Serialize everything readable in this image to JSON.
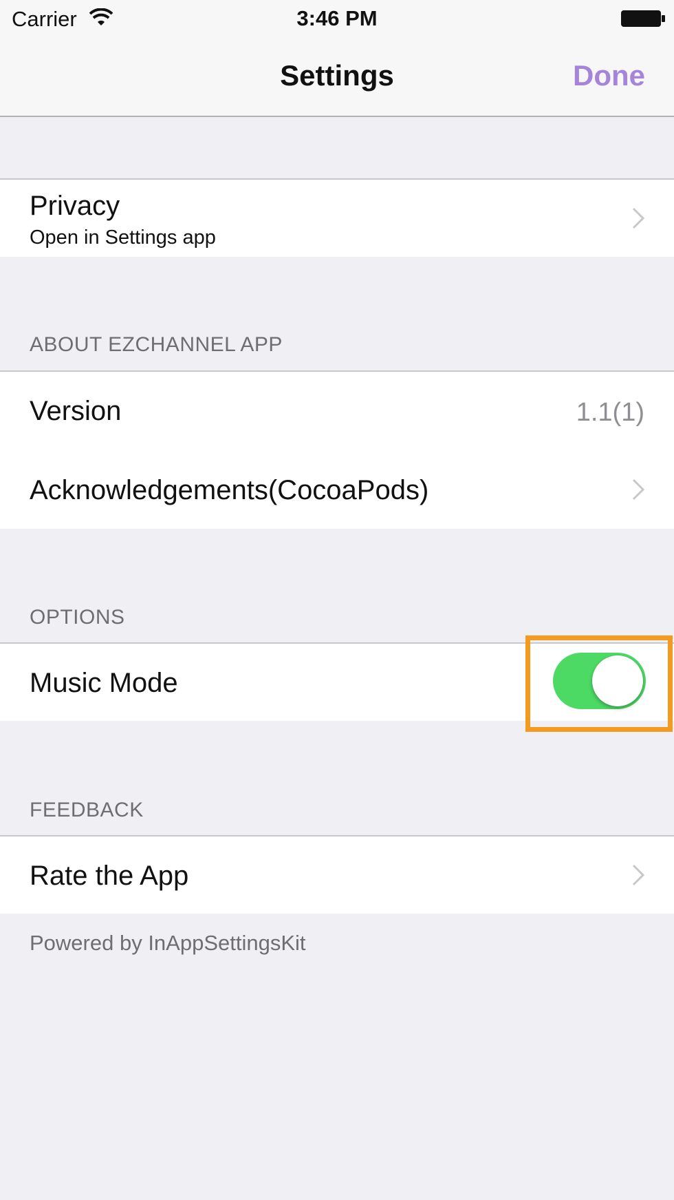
{
  "status_bar": {
    "carrier": "Carrier",
    "time": "3:46 PM"
  },
  "nav": {
    "title": "Settings",
    "done_label": "Done"
  },
  "privacy": {
    "title": "Privacy",
    "subtitle": "Open in Settings app"
  },
  "about": {
    "header": "ABOUT EZCHANNEL APP",
    "version_label": "Version",
    "version_value": "1.1(1)",
    "acknowledgements_label": "Acknowledgements(CocoaPods)"
  },
  "options": {
    "header": "OPTIONS",
    "music_mode_label": "Music Mode",
    "music_mode_on": true
  },
  "feedback": {
    "header": "FEEDBACK",
    "rate_label": "Rate the App"
  },
  "footer": "Powered by InAppSettingsKit",
  "colors": {
    "accent": "#a585da",
    "switch_on": "#4cd964",
    "highlight": "#f29b1f"
  }
}
